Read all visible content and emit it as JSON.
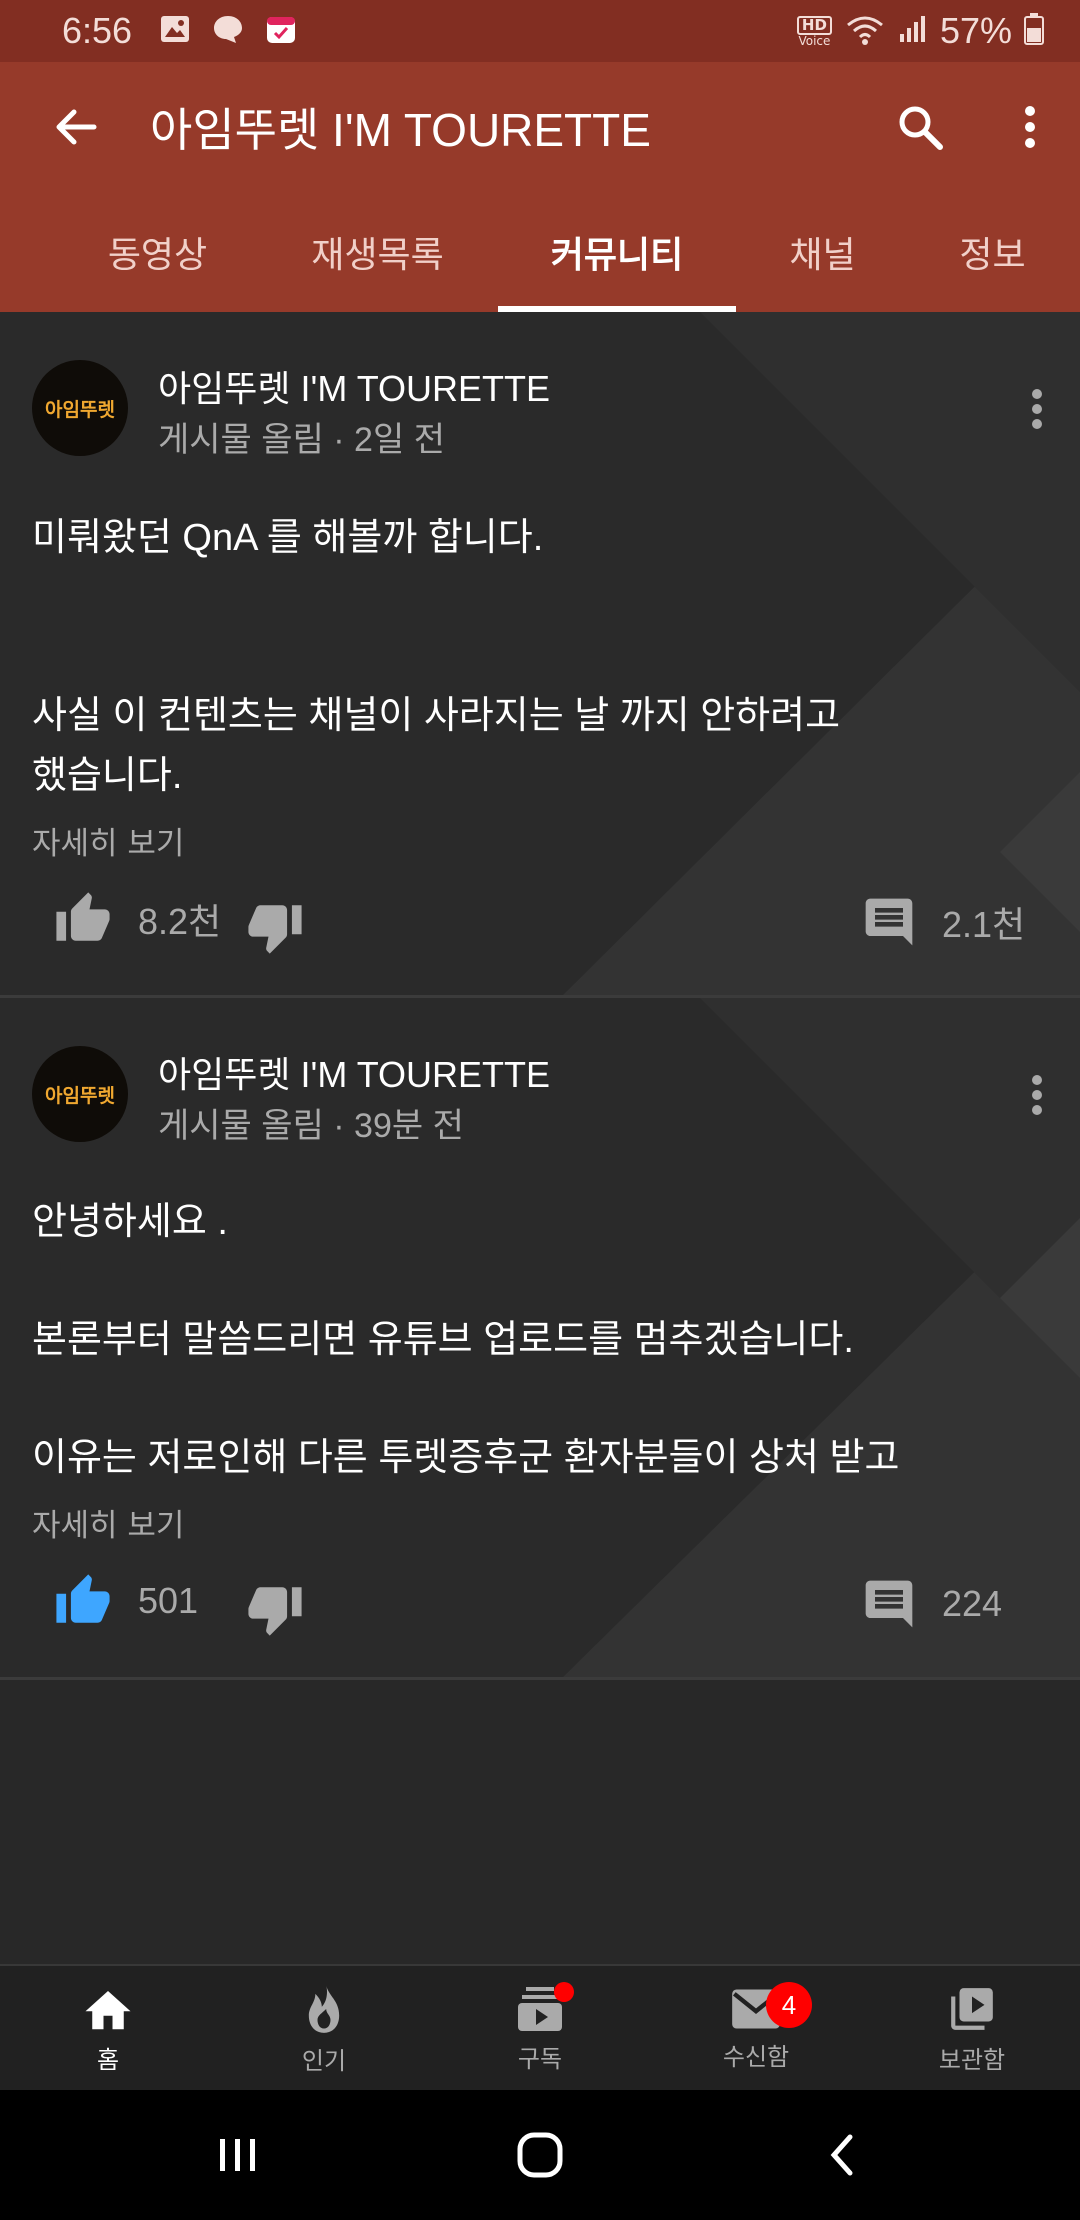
{
  "status_bar": {
    "time": "6:56",
    "battery_percent": "57%",
    "hd_label": "HD",
    "voice_label": "Voice",
    "left_icons": [
      "image-icon",
      "message-bubble-icon",
      "calendar-icon"
    ],
    "right_icons": [
      "hd-voice-icon",
      "wifi-icon",
      "signal-icon",
      "battery-icon"
    ]
  },
  "app_bar": {
    "title": "아임뚜렛 I'M TOURETTE",
    "tabs": [
      {
        "label": "동영상"
      },
      {
        "label": "재생목록"
      },
      {
        "label": "커뮤니티",
        "active": true
      },
      {
        "label": "채널"
      },
      {
        "label": "정보"
      }
    ]
  },
  "posts": [
    {
      "avatar_text": "아임뚜렛",
      "channel": "아임뚜렛 I'M TOURETTE",
      "meta": "게시물 올림 · 2일 전",
      "lines": [
        "미뤄왔던 QnA 를 해볼까 합니다.",
        "사실 이 컨텐츠는 채널이 사라지는 날 까지 안하려고",
        "했습니다."
      ],
      "read_more": "자세히 보기",
      "likes": "8.2천",
      "liked": false,
      "comments": "2.1천"
    },
    {
      "avatar_text": "아임뚜렛",
      "channel": "아임뚜렛 I'M TOURETTE",
      "meta": "게시물 올림 · 39분 전",
      "lines": [
        "안녕하세요 .",
        "본론부터 말씀드리면 유튜브 업로드를 멈추겠습니다.",
        "이유는 저로인해 다른 투렛증후군 환자분들이 상처 받고"
      ],
      "read_more": "자세히 보기",
      "likes": "501",
      "liked": true,
      "comments": "224"
    }
  ],
  "bottom_nav": {
    "items": [
      {
        "label": "홈",
        "icon": "home-icon",
        "active": true
      },
      {
        "label": "인기",
        "icon": "trending-flame-icon"
      },
      {
        "label": "구독",
        "icon": "subscriptions-icon",
        "dot": true
      },
      {
        "label": "수신함",
        "icon": "inbox-mail-icon",
        "badge": "4"
      },
      {
        "label": "보관함",
        "icon": "library-icon"
      }
    ]
  },
  "colors": {
    "status_bar": "#822e22",
    "app_bar": "#963a2a",
    "background": "#282828",
    "like_active": "#3ea6ff",
    "badge": "#ff0000"
  }
}
